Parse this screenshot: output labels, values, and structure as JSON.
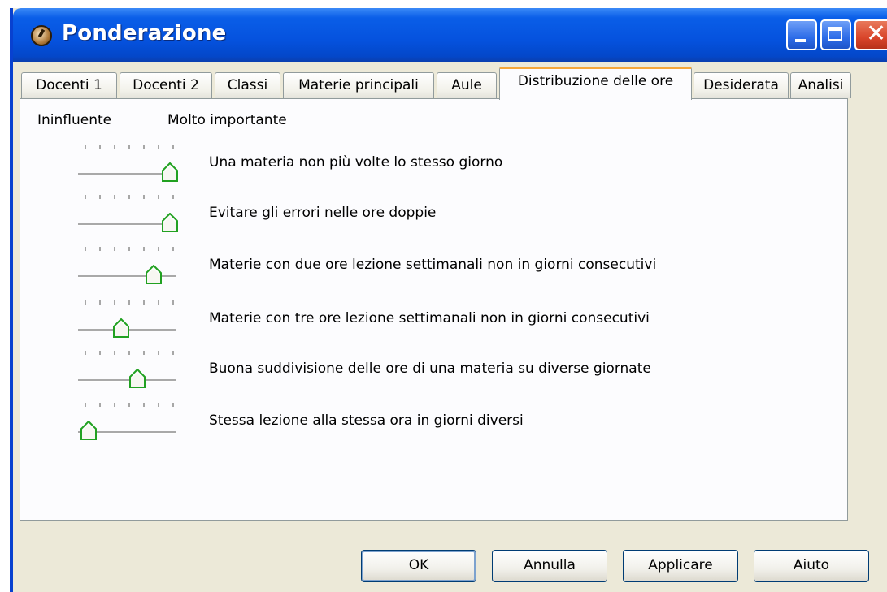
{
  "window": {
    "title": "Ponderazione"
  },
  "tabs": [
    {
      "label": "Docenti 1"
    },
    {
      "label": "Docenti 2"
    },
    {
      "label": "Classi"
    },
    {
      "label": "Materie principali"
    },
    {
      "label": "Aule"
    },
    {
      "label": "Distribuzione delle ore",
      "active": true
    },
    {
      "label": "Desiderata"
    },
    {
      "label": "Analisi"
    }
  ],
  "scale": {
    "low_label": "Ininfluente",
    "high_label": "Molto importante"
  },
  "sliders": [
    {
      "label": "Una materia non più volte lo stesso giorno",
      "value_fraction": 1.0
    },
    {
      "label": "Evitare gli errori nelle ore doppie",
      "value_fraction": 1.0
    },
    {
      "label": "Materie con due ore lezione settimanali non in giorni consecutivi",
      "value_fraction": 0.8
    },
    {
      "label": "Materie con tre ore lezione settimanali non in giorni consecutivi",
      "value_fraction": 0.4
    },
    {
      "label": "Buona suddivisione delle ore di una materia su diverse giornate",
      "value_fraction": 0.6
    },
    {
      "label": "Stessa lezione alla stessa ora in giorni diversi",
      "value_fraction": 0.0
    }
  ],
  "buttons": {
    "ok": "OK",
    "cancel": "Annulla",
    "apply": "Applicare",
    "help": "Aiuto"
  },
  "colors": {
    "title_bar": "#0552DE",
    "active_tab_accent": "#F5A73A",
    "thumb_accent": "#21A121",
    "dialog_bg": "#ECE9D8"
  }
}
